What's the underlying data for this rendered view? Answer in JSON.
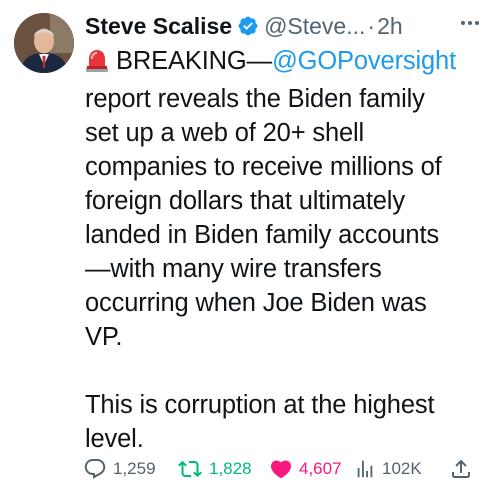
{
  "author": {
    "display_name": "Steve Scalise",
    "handle": "@Steve...",
    "separator": "·",
    "time": "2h",
    "avatar_icon": "profile-photo",
    "verified_icon": "verified-badge-icon",
    "verified_color": "#1d9bf0"
  },
  "tweet": {
    "siren_icon": "police-light-emoji",
    "breaking_label": "BREAKING—",
    "mention": "@GOPoversight",
    "lines": [
      "report reveals the Biden family",
      "set up a web of 20+ shell",
      "companies to receive millions of",
      "foreign dollars that ultimately",
      "landed in Biden family accounts",
      "—with many wire transfers",
      "occurring when Joe Biden was",
      "VP."
    ],
    "closing_lines": [
      "This is corruption at the highest",
      "level."
    ]
  },
  "actions": {
    "replies": "1,259",
    "reposts": "1,828",
    "likes": "4,607",
    "views": "102K"
  },
  "colors": {
    "text": "#0f1419",
    "secondary": "#536471",
    "link": "#1d9bf0",
    "repost": "#00ba7c",
    "like": "#f91880"
  }
}
